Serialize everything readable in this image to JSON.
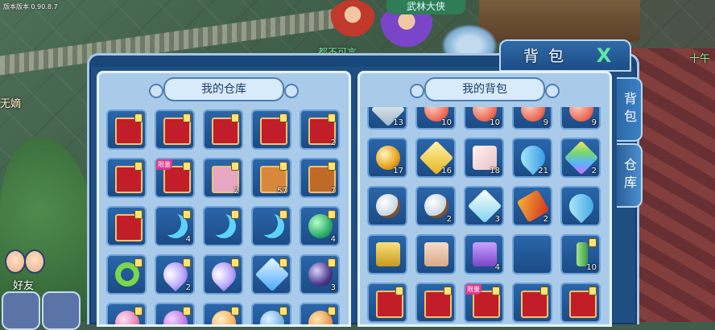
{
  "hud": {
    "version_text": "版本版本 0.90.8.7",
    "npc_label": "武林大侠",
    "npc_label_2": "都不可言",
    "right_edge_text": "十午",
    "left_edge_text": "无嫡",
    "friend_label": "好友"
  },
  "panel": {
    "title": "背包",
    "close_glyph": "X",
    "left_column_title": "我的仓库",
    "right_column_title": "我的背包",
    "side_tabs": [
      {
        "label": "背包",
        "active": false
      },
      {
        "label": "仓库",
        "active": true
      }
    ]
  },
  "warehouse": {
    "rows": [
      [
        {
          "icon": "red-card-icon",
          "count": "",
          "locked": true
        },
        {
          "icon": "red-card-icon",
          "count": "",
          "locked": true
        },
        {
          "icon": "red-card-icon",
          "count": "",
          "locked": true
        },
        {
          "icon": "red-card-icon",
          "count": "",
          "locked": true
        },
        {
          "icon": "red-card-icon",
          "count": "2",
          "locked": true
        }
      ],
      [
        {
          "icon": "red-card-icon",
          "count": "",
          "locked": true
        },
        {
          "icon": "red-card-icon",
          "count": "",
          "locked": true,
          "tag": "限量"
        },
        {
          "icon": "blue-card-icon",
          "count": "2",
          "locked": true
        },
        {
          "icon": "egg-card-icon",
          "count": "57",
          "locked": true
        },
        {
          "icon": "flame-card-icon",
          "count": "7",
          "locked": true
        }
      ],
      [
        {
          "icon": "red-card-icon",
          "count": "",
          "locked": true
        },
        {
          "icon": "crescent-icon",
          "count": "4",
          "locked": true
        },
        {
          "icon": "crescent-icon",
          "count": "",
          "locked": true
        },
        {
          "icon": "crescent-icon",
          "count": "",
          "locked": true
        },
        {
          "icon": "green-orb-icon",
          "count": "4",
          "locked": true
        }
      ],
      [
        {
          "icon": "green-ring-icon",
          "count": "",
          "locked": true
        },
        {
          "icon": "purple-drop-icon",
          "count": "2",
          "locked": true
        },
        {
          "icon": "purple-drop-icon",
          "count": "",
          "locked": true
        },
        {
          "icon": "blue-crystal-icon",
          "count": "",
          "locked": true
        },
        {
          "icon": "dark-orb-icon",
          "count": "3",
          "locked": true
        }
      ],
      [
        {
          "icon": "pink-orb-icon",
          "count": "",
          "locked": true
        },
        {
          "icon": "purple-orb-icon",
          "count": "",
          "locked": true
        },
        {
          "icon": "orange-orb-icon",
          "count": "",
          "locked": true
        },
        {
          "icon": "blue-orb-icon",
          "count": "",
          "locked": true
        },
        {
          "icon": "amber-orb-icon",
          "count": "",
          "locked": true
        }
      ]
    ]
  },
  "backpack": {
    "rows": [
      [
        {
          "icon": "shard-icon",
          "count": "13",
          "locked": false
        },
        {
          "icon": "red-orb-icon",
          "count": "10",
          "locked": false
        },
        {
          "icon": "red-orb-icon",
          "count": "10",
          "locked": false
        },
        {
          "icon": "red-orb-icon",
          "count": "9",
          "locked": false
        },
        {
          "icon": "red-orb-icon",
          "count": "9",
          "locked": false
        }
      ],
      [
        {
          "icon": "gold-orb-icon",
          "count": "17",
          "locked": false
        },
        {
          "icon": "gold-crystal-icon",
          "count": "16",
          "locked": false
        },
        {
          "icon": "pink-cube-icon",
          "count": "18",
          "locked": false
        },
        {
          "icon": "blue-horn-icon",
          "count": "21",
          "locked": false
        },
        {
          "icon": "rainbow-gem-icon",
          "count": "2",
          "locked": false
        }
      ],
      [
        {
          "icon": "crystal-ball-icon",
          "count": "",
          "locked": false
        },
        {
          "icon": "crystal-ball-icon",
          "count": "2",
          "locked": false
        },
        {
          "icon": "ice-shard-icon",
          "count": "3",
          "locked": false
        },
        {
          "icon": "red-scroll-icon",
          "count": "2",
          "locked": false
        },
        {
          "icon": "blue-spirit-icon",
          "count": "",
          "locked": false
        }
      ],
      [
        {
          "icon": "gold-scroll-icon",
          "count": "",
          "locked": false
        },
        {
          "icon": "map-scroll-icon",
          "count": "",
          "locked": false
        },
        {
          "icon": "purple-box-icon",
          "count": "4",
          "locked": false
        },
        {
          "icon": "empty-slot",
          "count": "",
          "locked": false
        },
        {
          "icon": "bamboo-icon",
          "count": "10",
          "locked": true
        }
      ],
      [
        {
          "icon": "red-card-icon",
          "count": "",
          "locked": true
        },
        {
          "icon": "red-card-icon",
          "count": "",
          "locked": true
        },
        {
          "icon": "red-card-icon",
          "count": "",
          "locked": true,
          "tag": "限量"
        },
        {
          "icon": "red-card-icon",
          "count": "",
          "locked": true
        },
        {
          "icon": "red-card-icon",
          "count": "",
          "locked": true
        }
      ]
    ]
  },
  "colors": {
    "panel_bg": "#1f4e83",
    "slot_bg": "#2a66aa",
    "column_bg": "#a9cbe9",
    "close_green": "#61e4a4",
    "count_text": "#ffffff"
  }
}
